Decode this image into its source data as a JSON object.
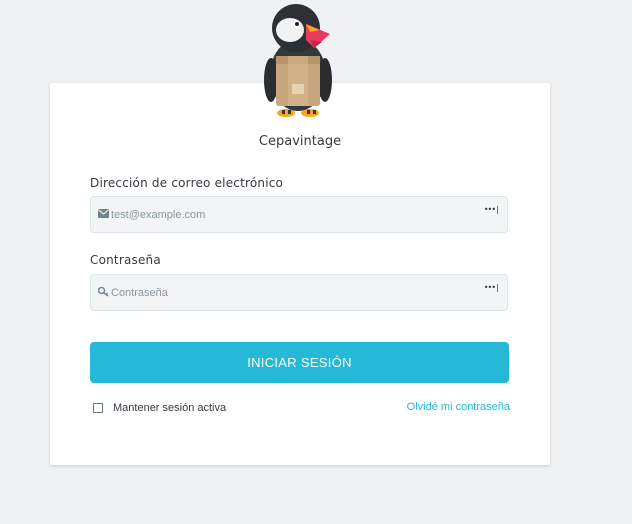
{
  "shop": {
    "name": "Cepavintage"
  },
  "login": {
    "email_label": "Dirección de correo electrónico",
    "email_placeholder": "test@example.com",
    "email_value": "",
    "password_label": "Contraseña",
    "password_placeholder": "Contraseña",
    "password_value": "",
    "password_manager_glyph": "•••|",
    "submit_label": "INICIAR SESIÓN",
    "remember_label": "Mantener sesión activa",
    "remember_checked": false,
    "forgot_label": "Olvidé mi contraseña"
  },
  "icons": {
    "mascot": "puffin-mascot-logo",
    "email": "envelope-icon",
    "password": "key-icon"
  },
  "colors": {
    "background": "#eff1f2",
    "accent": "#25b9d7",
    "card": "#ffffff",
    "input_bg": "#f2f4f5"
  }
}
